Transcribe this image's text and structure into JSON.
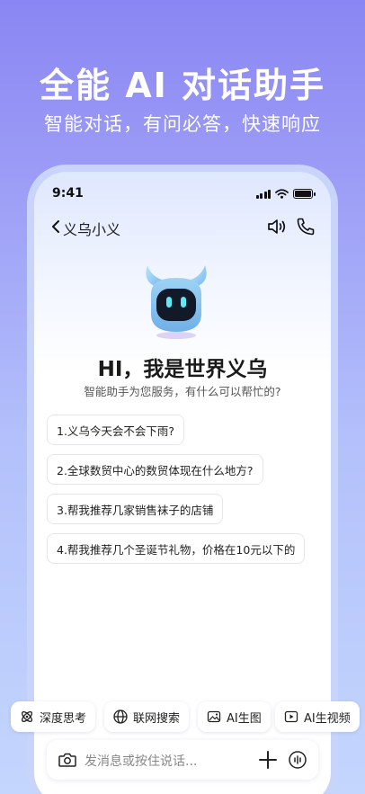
{
  "promo": {
    "title": "全能 AI 对话助手",
    "subtitle": "智能对话，有问必答，快速响应"
  },
  "status_bar": {
    "time": "9:41"
  },
  "nav": {
    "title": "义乌小义"
  },
  "welcome": {
    "greeting": "HI，我是世界义乌",
    "subtitle": "智能助手为您服务，有什么可以帮忙的?"
  },
  "suggestions": [
    "1.义乌今天会不会下雨?",
    "2.全球数贸中心的数贸体现在什么地方?",
    "3.帮我推荐几家销售袜子的店铺",
    "4.帮我推荐几个圣诞节礼物，价格在10元以下的"
  ],
  "chips": {
    "deep_think": "深度思考",
    "web_search": "联网搜索",
    "ai_image": "AI生图",
    "ai_video": "AI生视频"
  },
  "input": {
    "placeholder": "发消息或按住说话..."
  },
  "colors": {
    "accent": "#8a86f3",
    "mascot_body": "#8ec8f2",
    "mascot_eyes": "#5ee9f5"
  }
}
